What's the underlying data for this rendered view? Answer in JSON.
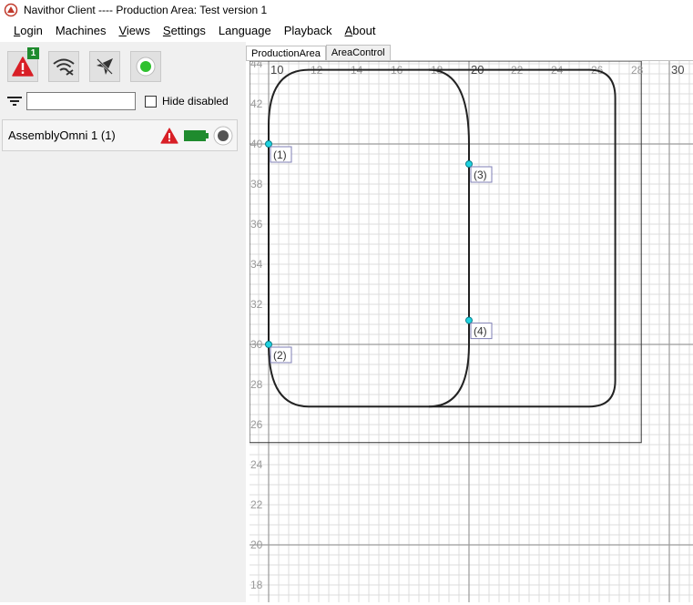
{
  "window": {
    "title": "Navithor Client ---- Production Area: Test version 1"
  },
  "menu": [
    {
      "label": "Login",
      "accel": "L",
      "rest": "ogin"
    },
    {
      "label": "Machines",
      "accel": "",
      "rest": "Machines"
    },
    {
      "label": "Views",
      "accel": "V",
      "rest": "iews"
    },
    {
      "label": "Settings",
      "accel": "S",
      "rest": "ettings"
    },
    {
      "label": "Language",
      "accel": "",
      "rest": "Language"
    },
    {
      "label": "Playback",
      "accel": "",
      "rest": "Playback"
    },
    {
      "label": "About",
      "accel": "A",
      "rest": "bout"
    }
  ],
  "toolbar": {
    "alarm_count": "1",
    "icons": [
      "alarm-icon",
      "wifi-off-icon",
      "navigation-off-icon",
      "status-ok-icon"
    ]
  },
  "filter": {
    "value": "",
    "hide_disabled_label": "Hide disabled",
    "hide_disabled_checked": false
  },
  "machine": {
    "name": "AssemblyOmni 1 (1)"
  },
  "tabs": [
    "ProductionArea",
    "AreaControl"
  ],
  "grid": {
    "x_labels": [
      "10",
      "12",
      "14",
      "16",
      "18",
      "20",
      "22",
      "24",
      "26",
      "28",
      "30"
    ],
    "y_labels": [
      "44",
      "42",
      "40",
      "38",
      "36",
      "34",
      "32",
      "30",
      "28",
      "26",
      "24",
      "22",
      "20",
      "18"
    ],
    "points": [
      {
        "label": "(1)",
        "x": 10,
        "y": 40
      },
      {
        "label": "(2)",
        "x": 10,
        "y": 30
      },
      {
        "label": "(3)",
        "x": 20,
        "y": 39
      },
      {
        "label": "(4)",
        "x": 20,
        "y": 31.2
      }
    ]
  },
  "colors": {
    "alarm": "#d81f26",
    "badge": "#1f8b2e",
    "battery": "#1f8b2e",
    "status_ok": "#2fc12f",
    "point": "#1ed3e0"
  }
}
